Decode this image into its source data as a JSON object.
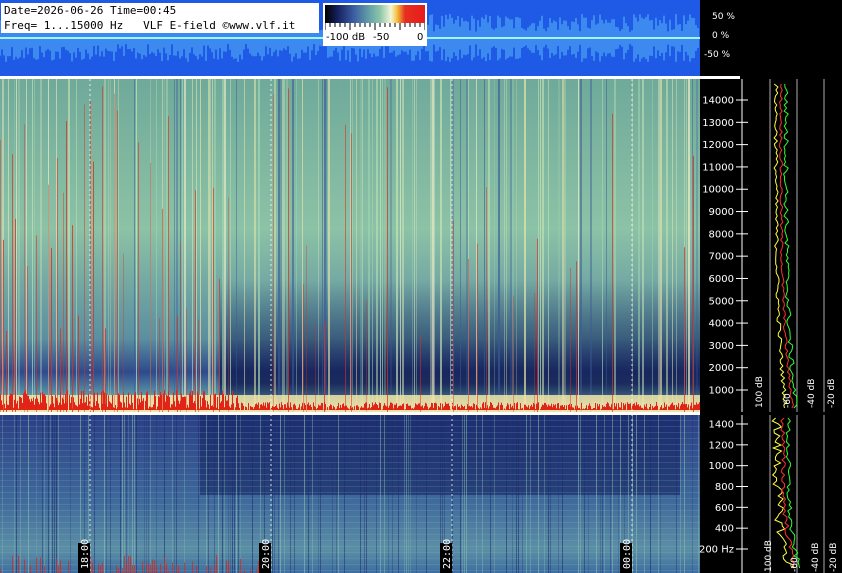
{
  "header": {
    "line1": "Date=2026-06-26 Time=00:45",
    "line2": "Freq= 1...15000 Hz   VLF E-field ©www.vlf.it"
  },
  "colorbar": {
    "labels": [
      "-100 dB",
      "-50",
      "0"
    ]
  },
  "amplitude_scale": [
    "50 %",
    "0 %",
    "-50 %"
  ],
  "upper_freq_labels": [
    "14000",
    "13000",
    "12000",
    "11000",
    "10000",
    "9000",
    "8000",
    "7000",
    "6000",
    "5000",
    "4000",
    "3000",
    "2000",
    "1000"
  ],
  "lower_freq_labels": [
    "1400",
    "1200",
    "1000",
    "800",
    "600",
    "400",
    "200 Hz"
  ],
  "db_labels": [
    "100 dB",
    "-60",
    "-40 dB",
    "-20 dB"
  ],
  "time_labels": [
    "18:00",
    "20:00",
    "22:00",
    "00:00"
  ],
  "colors": {
    "wave_bg": "#1e5ae6",
    "wave_line": "#7ef0ff",
    "spectrum_yellow": "#ffff40",
    "spectrum_green": "#30ff30",
    "spectrum_red": "#ff3030",
    "grid": "#c0c0c0"
  }
}
